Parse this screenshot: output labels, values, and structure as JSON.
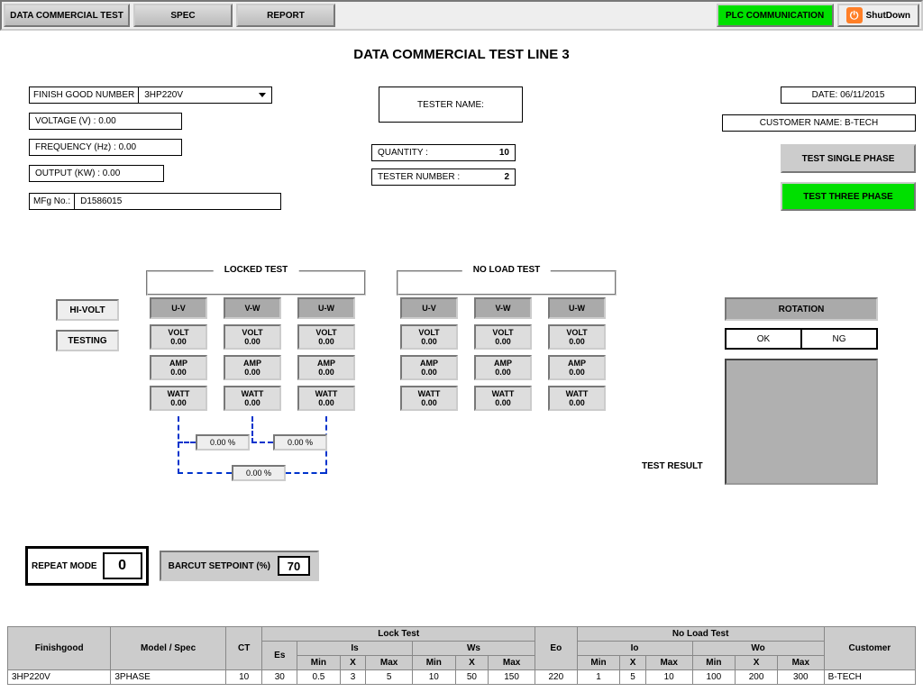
{
  "topbar": {
    "data_test": "DATA COMMERCIAL TEST",
    "spec": "SPEC",
    "report": "REPORT",
    "plc": "PLC COMMUNICATION",
    "shutdown": "ShutDown"
  },
  "title": "DATA COMMERCIAL TEST LINE 3",
  "left": {
    "fg_label": "FINISH GOOD NUMBER",
    "fg_value": "3HP220V",
    "voltage": "VOLTAGE (V) : 0.00",
    "frequency": "FREQUENCY (Hz) : 0.00",
    "output": "OUTPUT (KW) : 0.00",
    "mfg_label": "MFg No.:",
    "mfg_value": "D1586015"
  },
  "center": {
    "tester_name": "TESTER NAME:",
    "qty_label": "QUANTITY :",
    "qty_value": "10",
    "tester_num_label": "TESTER NUMBER :",
    "tester_num_value": "2"
  },
  "right": {
    "date": "DATE: 06/11/2015",
    "customer": "CUSTOMER NAME: B-TECH",
    "single": "TEST SINGLE PHASE",
    "three": "TEST THREE PHASE"
  },
  "status": {
    "hivolt": "HI-VOLT",
    "testing": "TESTING"
  },
  "groups": {
    "locked": "LOCKED TEST",
    "noload": "NO LOAD TEST",
    "uv": "U-V",
    "vw": "V-W",
    "uw": "U-W",
    "volt": "VOLT",
    "amp": "AMP",
    "watt": "WATT",
    "zero": "0.00",
    "pct": "0.00 %"
  },
  "rotation": {
    "label": "ROTATION",
    "ok": "OK",
    "ng": "NG",
    "result_label": "TEST RESULT"
  },
  "bottom": {
    "repeat": "REPEAT MODE",
    "repeat_val": "0",
    "barcut": "BARCUT SETPOINT (%)",
    "barcut_val": "70"
  },
  "table": {
    "headers": {
      "finishgood": "Finishgood",
      "model": "Model / Spec",
      "ct": "CT",
      "es": "Es",
      "locktest": "Lock Test",
      "noloadtest": "No Load Test",
      "is": "Is",
      "ws": "Ws",
      "eo": "Eo",
      "io": "Io",
      "wo": "Wo",
      "min": "Min",
      "x": "X",
      "max": "Max",
      "customer": "Customer"
    },
    "row": {
      "fg": "3HP220V",
      "model": "3PHASE",
      "ct": "10",
      "es": "30",
      "is_min": "0.5",
      "is_x": "3",
      "is_max": "5",
      "ws_min": "10",
      "ws_x": "50",
      "ws_max": "150",
      "eo": "220",
      "io_min": "1",
      "io_x": "5",
      "io_max": "10",
      "wo_min": "100",
      "wo_x": "200",
      "wo_max": "300",
      "customer": "B-TECH"
    }
  }
}
